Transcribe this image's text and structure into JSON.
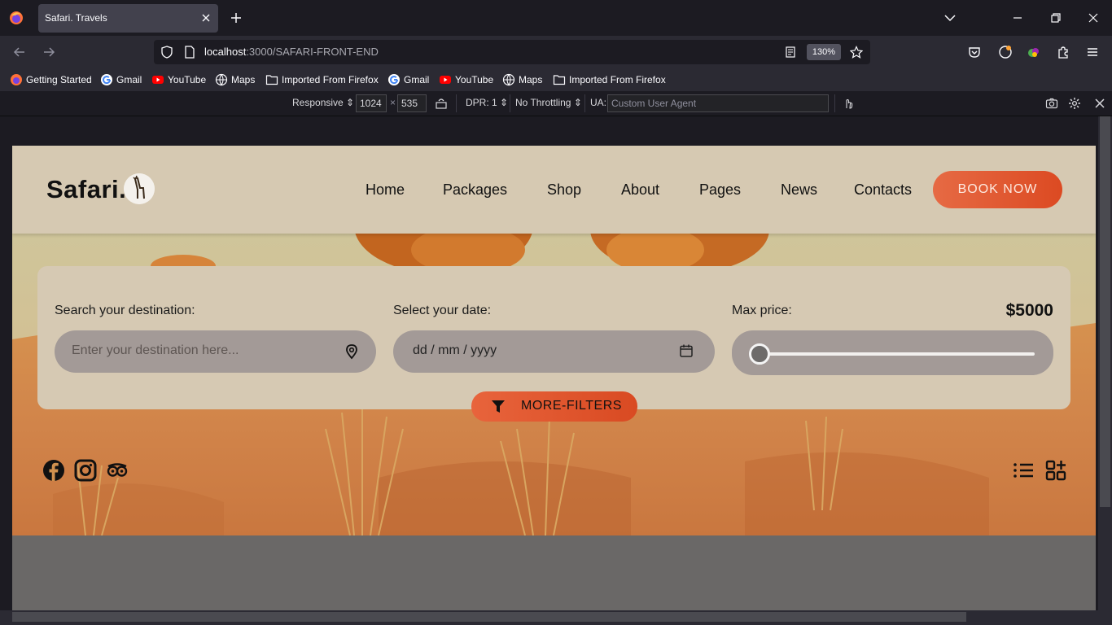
{
  "browser": {
    "tab_title": "Safari. Travels",
    "url_host": "localhost",
    "url_path": ":3000/SAFARI-FRONT-END",
    "zoom": "130%",
    "bookmarks": [
      {
        "label": "Getting Started",
        "icon": "firefox-icon"
      },
      {
        "label": "Gmail",
        "icon": "google-icon"
      },
      {
        "label": "YouTube",
        "icon": "youtube-icon"
      },
      {
        "label": "Maps",
        "icon": "globe-icon"
      },
      {
        "label": "Imported From Firefox",
        "icon": "folder-icon"
      },
      {
        "label": "Gmail",
        "icon": "google-icon"
      },
      {
        "label": "YouTube",
        "icon": "youtube-icon"
      },
      {
        "label": "Maps",
        "icon": "globe-icon"
      },
      {
        "label": "Imported From Firefox",
        "icon": "folder-icon"
      }
    ]
  },
  "rdm": {
    "device": "Responsive",
    "width": "1024",
    "times": "×",
    "height": "535",
    "dpr": "DPR: 1",
    "throttling": "No Throttling",
    "ua_label": "UA:",
    "ua_placeholder": "Custom User Agent"
  },
  "site": {
    "logo": "Safari.",
    "menu": [
      "Home",
      "Packages",
      "Shop",
      "About",
      "Pages",
      "News",
      "Contacts"
    ],
    "book_now": "BOOK NOW",
    "search": {
      "destination_label": "Search your destination:",
      "destination_placeholder": "Enter your destination here...",
      "date_label": "Select your date:",
      "date_placeholder": "dd / mm / yyyy",
      "price_label": "Max price:",
      "price_value": "$5000",
      "price_slider_fraction": 0
    },
    "more_filters": "MORE-FILTERS",
    "social_icons": [
      "facebook-icon",
      "instagram-icon",
      "tripadvisor-icon"
    ],
    "view_icons": [
      "list-view-icon",
      "grid-add-icon"
    ]
  },
  "colors": {
    "accent": "#e05a32",
    "header_bg": "#d6c9b2",
    "field_bg": "#a39a97"
  }
}
